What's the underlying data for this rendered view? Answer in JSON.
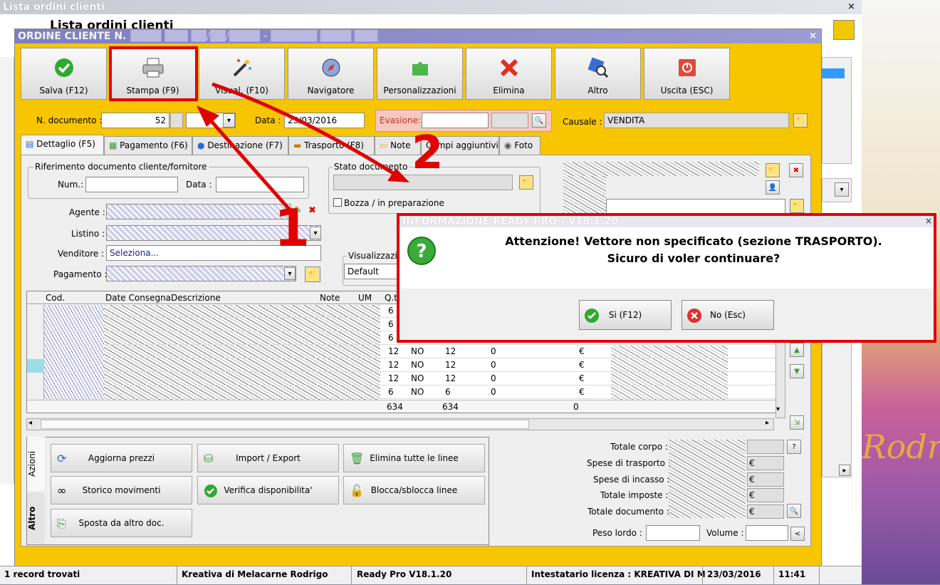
{
  "back_window": {
    "title": "Lista ordini clienti",
    "subtitle": "Lista ordini clienti",
    "close": "×"
  },
  "main_window": {
    "title": "ORDINE CLIENTE N.",
    "close": "×"
  },
  "toolbar": [
    {
      "label": "Salva (F12)",
      "icon": "check-icon"
    },
    {
      "label": "Stampa (F9)",
      "icon": "printer-icon"
    },
    {
      "label": "Visual. (F10)",
      "icon": "magic-wand-icon"
    },
    {
      "label": "Navigatore",
      "icon": "compass-icon"
    },
    {
      "label": "Personalizzazioni",
      "icon": "puzzle-icon"
    },
    {
      "label": "Elimina",
      "icon": "x-icon"
    },
    {
      "label": "Altro",
      "icon": "magnifier-icon"
    },
    {
      "label": "Uscita (ESC)",
      "icon": "exit-icon"
    }
  ],
  "header": {
    "ndoc_label": "N. documento :",
    "ndoc_value": "52",
    "data_label": "Data :",
    "data_value": "23/03/2016",
    "evasione_label": "Evasione:",
    "causale_label": "Causale :",
    "causale_value": "VENDITA"
  },
  "tabs": [
    "Dettaglio (F5)",
    "Pagamento (F6)",
    "Destinazione (F7)",
    "Trasporto (F8)",
    "Note",
    "Campi aggiuntivi",
    "Foto"
  ],
  "riferimento": {
    "title": "Riferimento documento cliente/fornitore",
    "num_label": "Num.:",
    "data_label": "Data :"
  },
  "stato": {
    "title": "Stato documento",
    "bozza_label": "Bozza / in preparazione"
  },
  "fields": {
    "agente_label": "Agente :",
    "listino_label": "Listino :",
    "venditore_label": "Venditore :",
    "venditore_value": "Seleziona...",
    "pagamento_label": "Pagamento :",
    "visualizza_label": "Visualizzazione",
    "visualizza_value": "Default"
  },
  "grid": {
    "headers": [
      "Cod.",
      "Date Consegna",
      "Descrizione",
      "Note",
      "UM",
      "Q.t"
    ],
    "rows": [
      {
        "q1": "6",
        "no": "",
        "q2": "",
        "z": ""
      },
      {
        "q1": "6",
        "no": "",
        "q2": "",
        "z": ""
      },
      {
        "q1": "6",
        "no": "",
        "q2": "",
        "z": ""
      },
      {
        "q1": "12",
        "no": "NO",
        "q2": "12",
        "z": "0",
        "eur": "€"
      },
      {
        "q1": "12",
        "no": "NO",
        "q2": "12",
        "z": "0",
        "eur": "€"
      },
      {
        "q1": "12",
        "no": "NO",
        "q2": "12",
        "z": "0",
        "eur": "€"
      },
      {
        "q1": "6",
        "no": "NO",
        "q2": "6",
        "z": "0",
        "eur": "€"
      }
    ],
    "totals": {
      "q1": "634",
      "q2": "634",
      "z": "0"
    }
  },
  "actions": {
    "tab_azioni": "Azioni",
    "tab_altro": "Altro",
    "buttons": [
      "Aggiorna prezzi",
      "Import / Export",
      "Elimina tutte le linee",
      "Storico movimenti",
      "Verifica disponibilita'",
      "Blocca/sblocca linee",
      "Sposta da altro doc."
    ]
  },
  "totali": {
    "corpo": "Totale corpo :",
    "trasporto": "Spese di trasporto :",
    "incasso": "Spese di incasso :",
    "imposte": "Totale imposte :",
    "documento": "Totale documento :",
    "peso": "Peso lordo :",
    "volume": "Volume :",
    "eur": "€",
    "help": "?",
    "less": "<"
  },
  "status": [
    "1 record trovati",
    "Kreativa di Melacarne Rodrigo",
    "Ready Pro V18.1.20",
    "Intestatario licenza : KREATIVA DI M",
    "23/03/2016",
    "11:41"
  ],
  "dialog": {
    "title": "INFORMAZIONE READY PRO - V18.1.20",
    "line1": "Attenzione! Vettore non specificato (sezione TRASPORTO).",
    "line2": "Sicuro di voler continuare?",
    "yes": "Sì (F12)",
    "no": "No (Esc)",
    "close": "×"
  },
  "annotations": {
    "n1": "1",
    "n2": "2"
  },
  "colors": {
    "accent": "#f7c600",
    "highlight": "#e00000",
    "title": "#8a8ad0"
  },
  "bg_text": "Rodr"
}
